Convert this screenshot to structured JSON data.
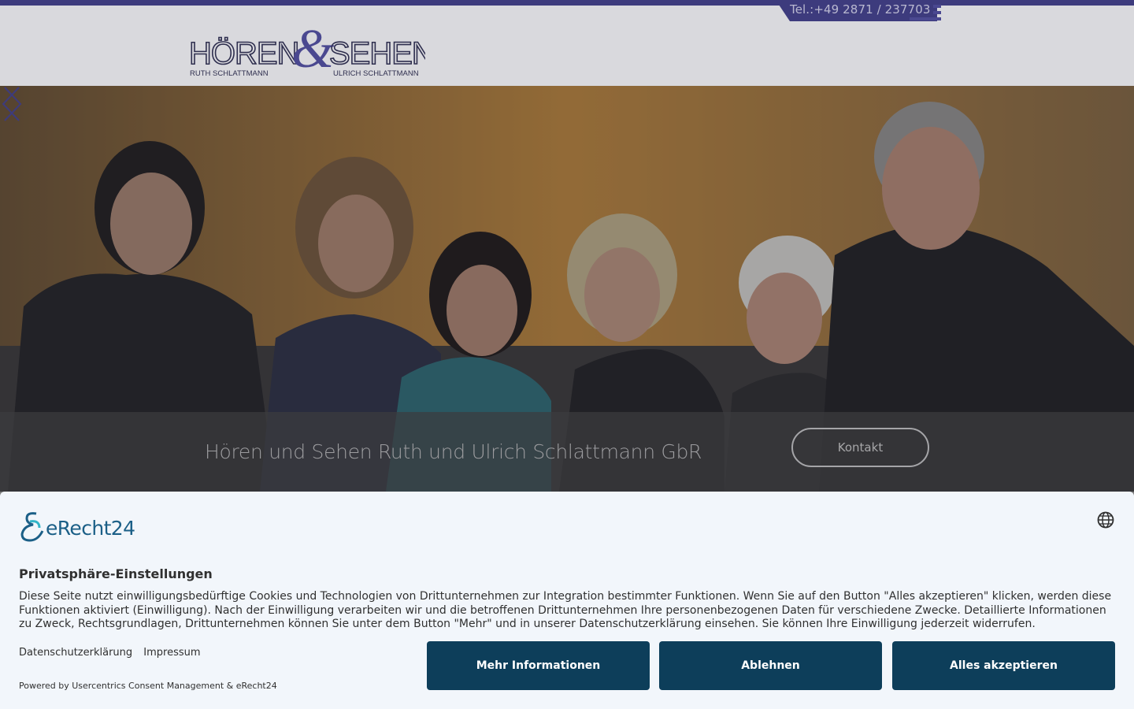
{
  "header": {
    "phone": "Tel.:+49 2871 / 237703",
    "logo": {
      "word_left": "HÖREN",
      "ampersand": "&",
      "word_right": "SEHEN",
      "sub_left": "RUTH SCHLATTMANN",
      "sub_right": "ULRICH SCHLATTMANN",
      "brand_color": "#3d3b7d"
    },
    "menu_icon": "menu-icon"
  },
  "hero": {
    "caption": "Hören und Sehen Ruth und Ulrich Schlattmann GbR",
    "kontakt_label": "Kontakt",
    "prev_icon": "chevron-left-icon",
    "next_icon": "chevron-right-icon"
  },
  "consent": {
    "brand": "eRecht24",
    "title": "Privatsphäre-Einstellungen",
    "body": "Diese Seite nutzt einwilligungsbedürftige Cookies und Technologien von Drittunternehmen zur Integration bestimmter Funktionen. Wenn Sie auf den Button \"Alles akzeptieren\" klicken, werden diese Funktionen aktiviert (Einwilligung). Nach der Einwilligung verarbeiten wir und die betroffenen Drittunternehmen Ihre personenbezogenen Daten für verschiedene Zwecke. Detaillierte Informationen zu Zweck, Rechtsgrundlagen, Drittunternehmen können Sie unter dem Button \"Mehr\" und in unserer Datenschutzerklärung einsehen. Sie können Ihre Einwilligung jederzeit widerrufen.",
    "link_privacy": "Datenschutzerklärung",
    "link_imprint": "Impressum",
    "powered": "Powered by Usercentrics Consent Management & eRecht24",
    "btn_more": "Mehr Informationen",
    "btn_decline": "Ablehnen",
    "btn_accept": "Alles akzeptieren",
    "button_color": "#0d3e5a"
  }
}
